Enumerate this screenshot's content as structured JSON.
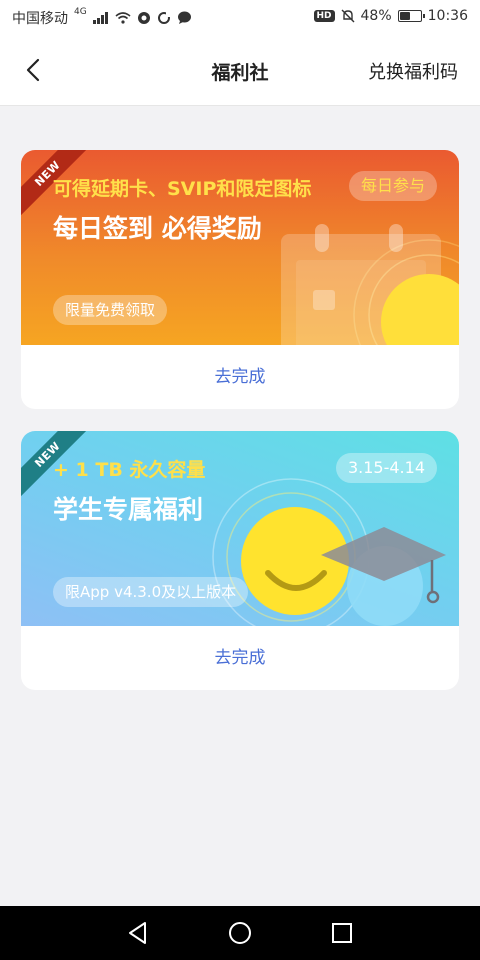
{
  "status_bar": {
    "carrier": "中国移动",
    "network": "4G",
    "hd": "HD",
    "battery_text": "48%",
    "battery_level": 0.48,
    "time": "10:36"
  },
  "header": {
    "title": "福利社",
    "redeem_link": "兑换福利码"
  },
  "cards": [
    {
      "badge": "NEW",
      "subtitle": "可得延期卡、SVIP和限定图标",
      "headline": "每日签到 必得奖励",
      "top_chip": "每日参与",
      "bottom_chip": "限量免费领取",
      "action": "去完成",
      "theme": "#f08a2a"
    },
    {
      "badge": "NEW",
      "subtitle": "+ 1 TB 永久容量",
      "headline": "学生专属福利",
      "top_chip": "3.15-4.14",
      "bottom_chip": "限App v4.3.0及以上版本",
      "action": "去完成",
      "theme": "#6fd3ee"
    }
  ],
  "colors": {
    "accent": "#4a6fd6",
    "highlight": "#ffe04a"
  },
  "icons": {
    "back": "back-arrow-icon",
    "nav_back": "triangle-back-icon",
    "nav_home": "circle-home-icon",
    "nav_recent": "square-recents-icon"
  }
}
